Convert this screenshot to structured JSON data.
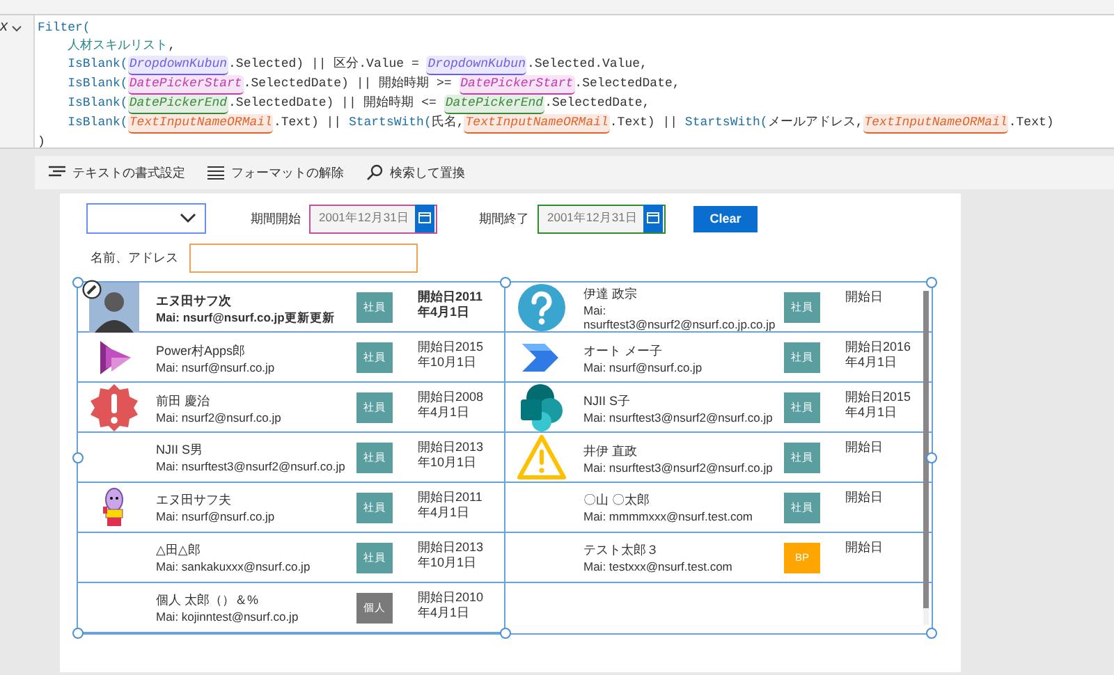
{
  "formula_bar": {
    "gutter_label": "x",
    "lines": [
      {
        "segments": [
          {
            "kind": "function",
            "text": "Filter("
          }
        ]
      },
      {
        "segments": [
          {
            "kind": "table",
            "text": "    人材スキルリスト"
          },
          {
            "kind": "plain",
            "text": ","
          }
        ]
      },
      {
        "segments": [
          {
            "kind": "function",
            "text": "    IsBlank("
          },
          {
            "kind": "control",
            "text": "DropdownKubun",
            "color": "#6b5fe0"
          },
          {
            "kind": "plain",
            "text": ".Selected) || 区分.Value = "
          },
          {
            "kind": "control",
            "text": "DropdownKubun",
            "color": "#6b5fe0"
          },
          {
            "kind": "plain",
            "text": ".Selected.Value,"
          }
        ]
      },
      {
        "segments": [
          {
            "kind": "function",
            "text": "    IsBlank("
          },
          {
            "kind": "control",
            "text": "DatePickerStart",
            "color": "#c239b3"
          },
          {
            "kind": "plain",
            "text": ".SelectedDate) || 開始時期 >= "
          },
          {
            "kind": "control",
            "text": "DatePickerStart",
            "color": "#c239b3"
          },
          {
            "kind": "plain",
            "text": ".SelectedDate,"
          }
        ]
      },
      {
        "segments": [
          {
            "kind": "function",
            "text": "    IsBlank("
          },
          {
            "kind": "control",
            "text": "DatePickerEnd",
            "color": "#3a8a3a"
          },
          {
            "kind": "plain",
            "text": ".SelectedDate) || 開始時期 <= "
          },
          {
            "kind": "control",
            "text": "DatePickerEnd",
            "color": "#3a8a3a"
          },
          {
            "kind": "plain",
            "text": ".SelectedDate,"
          }
        ]
      },
      {
        "segments": [
          {
            "kind": "function",
            "text": "    IsBlank("
          },
          {
            "kind": "control",
            "text": "TextInputNameORMail",
            "color": "#e0642a"
          },
          {
            "kind": "plain",
            "text": ".Text) || "
          },
          {
            "kind": "function",
            "text": "StartsWith("
          },
          {
            "kind": "plain",
            "text": "氏名,"
          },
          {
            "kind": "control",
            "text": "TextInputNameORMail",
            "color": "#e0642a"
          },
          {
            "kind": "plain",
            "text": ".Text) || "
          },
          {
            "kind": "function",
            "text": "StartsWith("
          },
          {
            "kind": "plain",
            "text": "メールアドレス,"
          },
          {
            "kind": "control",
            "text": "TextInputNameORMail",
            "color": "#e0642a"
          },
          {
            "kind": "plain",
            "text": ".Text)"
          }
        ]
      },
      {
        "segments": [
          {
            "kind": "plain",
            "text": ")"
          }
        ]
      }
    ]
  },
  "toolbar": {
    "items": [
      {
        "kind": "format",
        "label": "テキストの書式設定"
      },
      {
        "kind": "clear",
        "label": "フォーマットの解除"
      },
      {
        "kind": "search",
        "label": "検索して置換"
      }
    ]
  },
  "filters": {
    "date_pickers": [
      {
        "label": "期間開始",
        "value": "2001年12月31日",
        "color": "#c2509a"
      },
      {
        "label": "期間終了",
        "value": "2001年12月31日",
        "color": "#2e8b2e"
      }
    ],
    "clear_button": "Clear",
    "name_label": "名前、アドレス"
  },
  "gallery": {
    "items": [
      {
        "kind": "photo",
        "name": "エヌ田サフ次",
        "email": "Mai: nsurf@nsurf.co.jp更新更新",
        "badge": {
          "label": "社員",
          "color": "#5a9ea0"
        },
        "start": "開始日2011年4月1日",
        "selected": true
      },
      {
        "kind": "question",
        "name": "伊達 政宗",
        "email": "Mai: nsurftest3@nsurf2@nsurf.co.jp.co.jp",
        "badge": {
          "label": "社員",
          "color": "#5a9ea0"
        },
        "start": "開始日",
        "selected": false
      },
      {
        "kind": "apps",
        "name": "Power村Apps郎",
        "email": "Mai: nsurf@nsurf.co.jp",
        "badge": {
          "label": "社員",
          "color": "#5a9ea0"
        },
        "start": "開始日2015年10月1日",
        "selected": false
      },
      {
        "kind": "flow",
        "name": "オート メー子",
        "email": "Mai: nsurf@nsurf.co.jp",
        "badge": {
          "label": "社員",
          "color": "#5a9ea0"
        },
        "start": "開始日2016年4月1日",
        "selected": false
      },
      {
        "kind": "alert",
        "name": "前田 慶治",
        "email": "Mai: nsurf2@nsurf.co.jp",
        "badge": {
          "label": "社員",
          "color": "#5a9ea0"
        },
        "start": "開始日2008年4月1日",
        "selected": false
      },
      {
        "kind": "share",
        "name": "NJII S子",
        "email": "Mai: nsurftest3@nsurf2@nsurf.co.jp",
        "badge": {
          "label": "社員",
          "color": "#5a9ea0"
        },
        "start": "開始日2015年4月1日",
        "selected": false
      },
      {
        "kind": "blank",
        "name": "NJII S男",
        "email": "Mai: nsurftest3@nsurf2@nsurf.co.jp",
        "badge": {
          "label": "社員",
          "color": "#5a9ea0"
        },
        "start": "開始日2013年10月1日",
        "selected": false
      },
      {
        "kind": "warning",
        "name": "井伊 直政",
        "email": "Mai: nsurftest3@nsurf2@nsurf.co.jp",
        "badge": {
          "label": "社員",
          "color": "#5a9ea0"
        },
        "start": "開始日",
        "selected": false
      },
      {
        "kind": "character",
        "name": "エヌ田サフ夫",
        "email": "Mai: nsurf@nsurf.co.jp",
        "badge": {
          "label": "社員",
          "color": "#5a9ea0"
        },
        "start": "開始日2011年4月1日",
        "selected": false
      },
      {
        "kind": "blank",
        "name": "〇山 〇太郎",
        "email": "Mai: mmmmxxx@nsurf.test.com",
        "badge": {
          "label": "社員",
          "color": "#5a9ea0"
        },
        "start": "開始日",
        "selected": false
      },
      {
        "kind": "blank",
        "name": "△田△郎",
        "email": "Mai: sankakuxxx@nsurf.co.jp",
        "badge": {
          "label": "社員",
          "color": "#5a9ea0"
        },
        "start": "開始日2013年10月1日",
        "selected": false
      },
      {
        "kind": "blank",
        "name": "テスト太郎３",
        "email": "Mai: testxxx@nsurf.test.com",
        "badge": {
          "label": "BP",
          "color": "#ffa500"
        },
        "start": "開始日",
        "selected": false
      },
      {
        "kind": "blank",
        "name": "個人 太郎（）＆%",
        "email": "Mai: kojinntest@nsurf.co.jp",
        "badge": {
          "label": "個人",
          "color": "#7a7a7a"
        },
        "start": "開始日2010年4月1日",
        "selected": false
      }
    ]
  }
}
